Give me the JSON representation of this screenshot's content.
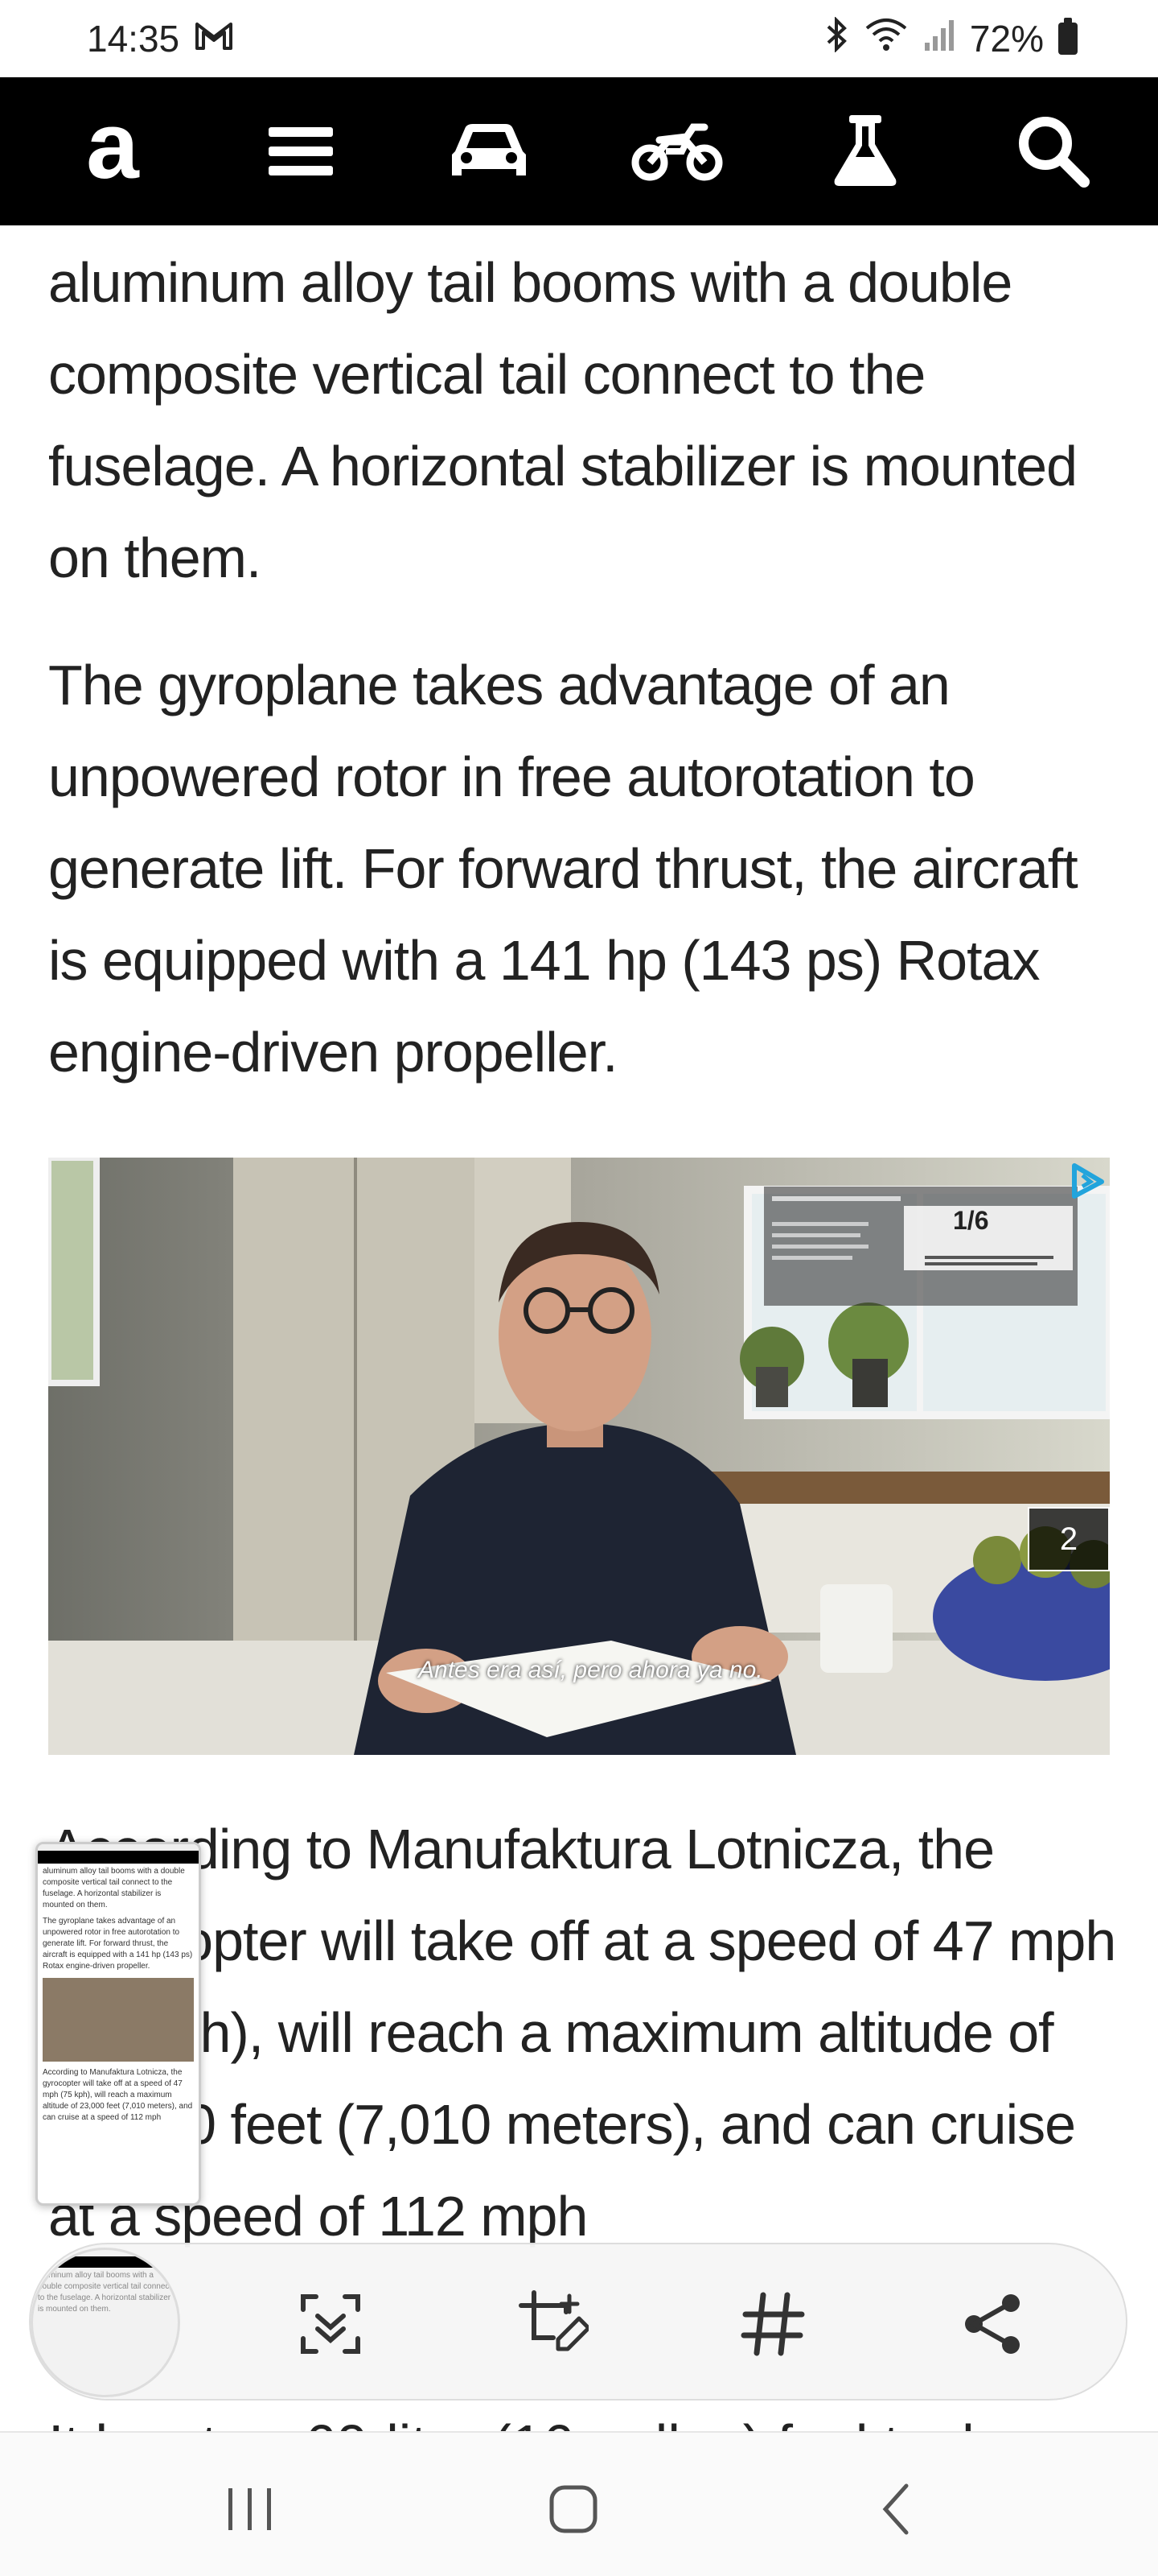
{
  "status_bar": {
    "time": "14:35",
    "battery": "72%"
  },
  "nav": {
    "logo": "a",
    "icons": [
      "menu-icon",
      "car-icon",
      "motorcycle-icon",
      "flask-icon",
      "search-icon"
    ]
  },
  "article": {
    "p1": "aluminum alloy tail booms with a double composite vertical tail connect to the fuselage. A horizontal stabilizer is mounted on them.",
    "p2": "The gyroplane takes advantage of an unpowered rotor in free autorotation to generate lift. For forward thrust, the aircraft is equipped with a 141 hp (143 ps) Rotax engine-driven propeller.",
    "p3": "According to Manufaktura Lotnicza, the gyrocopter will take off at a speed of 47 mph (75 kph), will reach a maximum altitude of 23,000 feet (7,010 meters), and can cruise at a speed of 112 mph",
    "p4_partial": "It has two 60-liter (16-gallon) fuel tanks"
  },
  "video_ad": {
    "caption": "Antes era así, pero ahora ya no.",
    "score": "1/6",
    "badge": "2"
  },
  "toolbar": {
    "icons": [
      "scan-text-icon",
      "crop-edit-icon",
      "hashtag-icon",
      "share-icon"
    ]
  },
  "system_nav": {
    "icons": [
      "recent-apps-icon",
      "home-icon",
      "back-icon"
    ]
  },
  "colors": {
    "nav_bg": "#000000",
    "text": "#222222"
  }
}
